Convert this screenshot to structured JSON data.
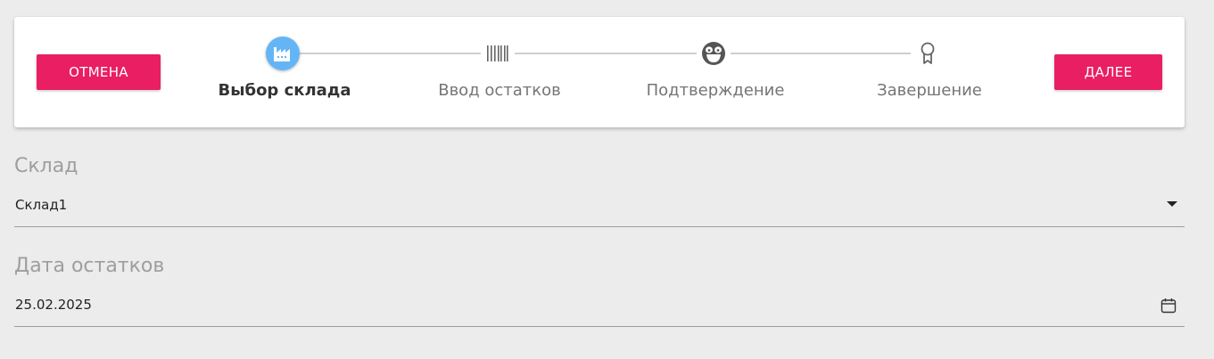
{
  "header": {
    "cancel_label": "ОТМЕНА",
    "next_label": "ДАЛЕЕ",
    "accent_color": "#e91e63",
    "active_step_color": "#64b5f6"
  },
  "stepper": {
    "steps": [
      {
        "label": "Выбор склада",
        "icon": "warehouse-icon",
        "active": true
      },
      {
        "label": "Ввод остатков",
        "icon": "barcode-icon",
        "active": false
      },
      {
        "label": "Подтверждение",
        "icon": "smiley-icon",
        "active": false
      },
      {
        "label": "Завершение",
        "icon": "award-icon",
        "active": false
      }
    ]
  },
  "form": {
    "warehouse": {
      "label": "Склад",
      "value": "Склад1"
    },
    "date": {
      "label": "Дата остатков",
      "value": "25.02.2025"
    }
  }
}
